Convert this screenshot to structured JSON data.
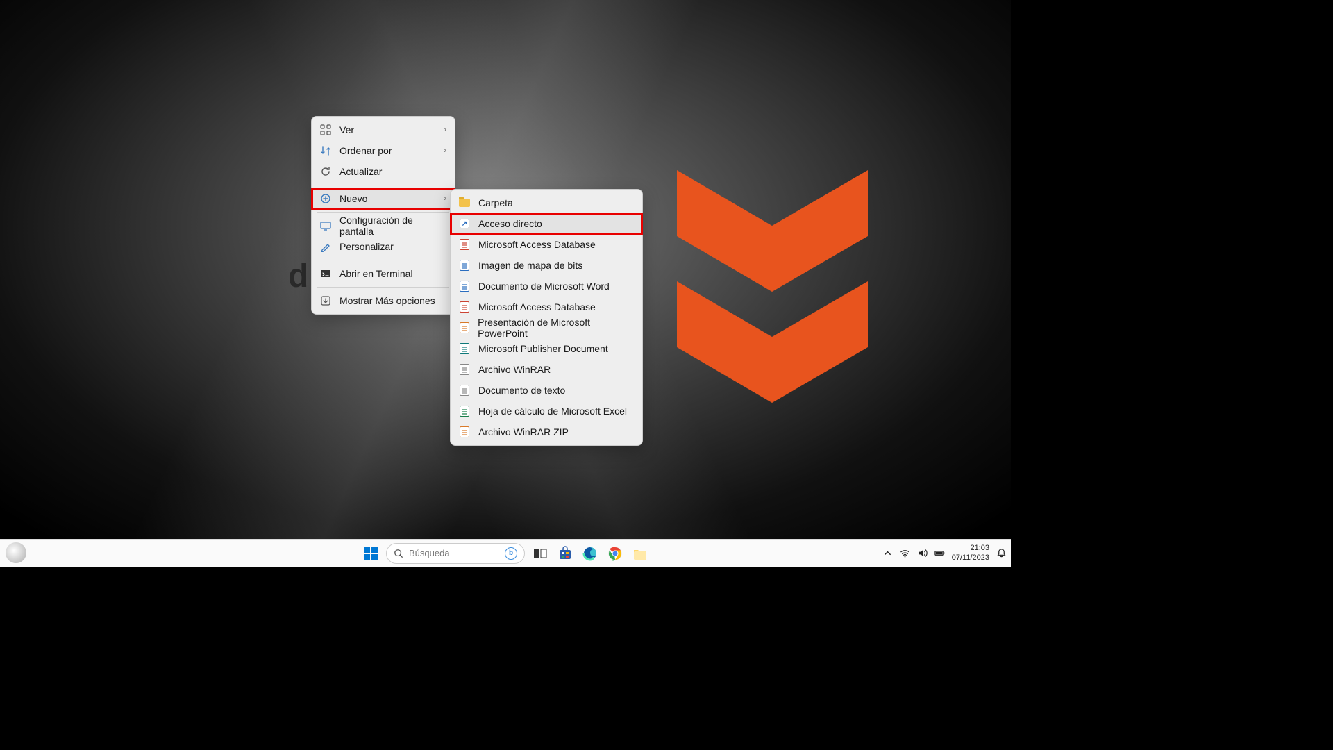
{
  "desktop": {
    "partial_text": "d"
  },
  "context_menu": {
    "items": [
      {
        "label": "Ver",
        "icon": "grid",
        "chevron": true
      },
      {
        "label": "Ordenar por",
        "icon": "sort",
        "chevron": true
      },
      {
        "label": "Actualizar",
        "icon": "refresh",
        "chevron": false
      },
      {
        "label": "Nuevo",
        "icon": "plus-circle",
        "chevron": true,
        "highlighted": true,
        "hover": true
      },
      {
        "label": "Configuración de pantalla",
        "icon": "display",
        "chevron": false
      },
      {
        "label": "Personalizar",
        "icon": "brush",
        "chevron": false
      },
      {
        "label": "Abrir en Terminal",
        "icon": "terminal",
        "chevron": false
      },
      {
        "label": "Mostrar Más opciones",
        "icon": "more",
        "chevron": false
      }
    ]
  },
  "submenu": {
    "items": [
      {
        "label": "Carpeta",
        "icon": "folder"
      },
      {
        "label": "Acceso directo",
        "icon": "shortcut",
        "highlighted": true,
        "hover": true
      },
      {
        "label": "Microsoft Access Database",
        "icon": "file-red"
      },
      {
        "label": "Imagen de mapa de bits",
        "icon": "file-blue"
      },
      {
        "label": "Documento de Microsoft Word",
        "icon": "file-blue"
      },
      {
        "label": "Microsoft Access Database",
        "icon": "file-red"
      },
      {
        "label": "Presentación de Microsoft PowerPoint",
        "icon": "file-orange"
      },
      {
        "label": "Microsoft Publisher Document",
        "icon": "file-teal"
      },
      {
        "label": "Archivo WinRAR",
        "icon": "file"
      },
      {
        "label": "Documento de texto",
        "icon": "file"
      },
      {
        "label": "Hoja de cálculo de Microsoft Excel",
        "icon": "file-green"
      },
      {
        "label": "Archivo WinRAR ZIP",
        "icon": "file-orange"
      }
    ]
  },
  "taskbar": {
    "search_placeholder": "Búsqueda",
    "time": "21:03",
    "date": "07/11/2023"
  }
}
